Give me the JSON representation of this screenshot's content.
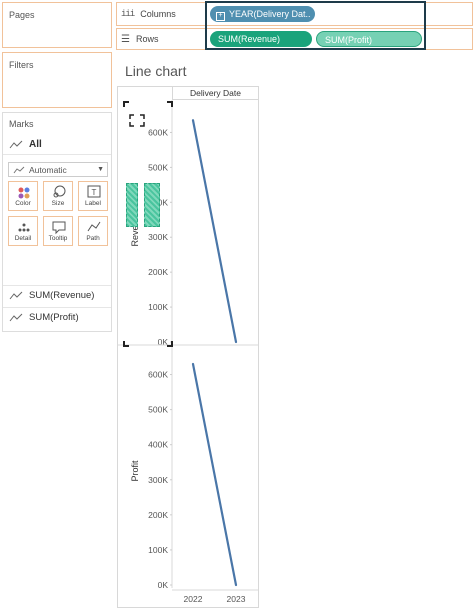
{
  "left_panel": {
    "pages_title": "Pages",
    "filters_title": "Filters",
    "marks_title": "Marks",
    "all_label": "All",
    "mark_type": "Automatic",
    "mark_buttons": [
      {
        "label": "Color",
        "icon": "color-dots-icon"
      },
      {
        "label": "Size",
        "icon": "size-icon"
      },
      {
        "label": "Label",
        "icon": "label-icon"
      },
      {
        "label": "Detail",
        "icon": "detail-icon"
      },
      {
        "label": "Tooltip",
        "icon": "tooltip-icon"
      },
      {
        "label": "Path",
        "icon": "path-icon"
      }
    ],
    "measures": [
      "SUM(Revenue)",
      "SUM(Profit)"
    ]
  },
  "shelves": {
    "columns_label": "Columns",
    "rows_label": "Rows",
    "columns_pills": [
      "YEAR(Delivery Dat.."
    ],
    "rows_pills": [
      "SUM(Revenue)",
      "SUM(Profit)"
    ]
  },
  "view": {
    "title": "Line chart",
    "column_header": "Delivery Date"
  },
  "chart_data": [
    {
      "type": "line",
      "x": [
        "2022",
        "2023"
      ],
      "series": [
        {
          "values": [
            635000,
            0
          ]
        }
      ],
      "ylabel": "Revenue",
      "yticks": [
        "0K",
        "100K",
        "200K",
        "300K",
        "400K",
        "500K",
        "600K"
      ],
      "ylim": [
        0,
        650000
      ],
      "color": "#4a76a8"
    },
    {
      "type": "line",
      "x": [
        "2022",
        "2023"
      ],
      "series": [
        {
          "values": [
            630000,
            0
          ]
        }
      ],
      "ylabel": "Profit",
      "yticks": [
        "0K",
        "100K",
        "200K",
        "300K",
        "400K",
        "500K",
        "600K"
      ],
      "ylim": [
        0,
        650000
      ],
      "color": "#4a76a8",
      "xlabels": [
        "2022",
        "2023"
      ]
    }
  ]
}
